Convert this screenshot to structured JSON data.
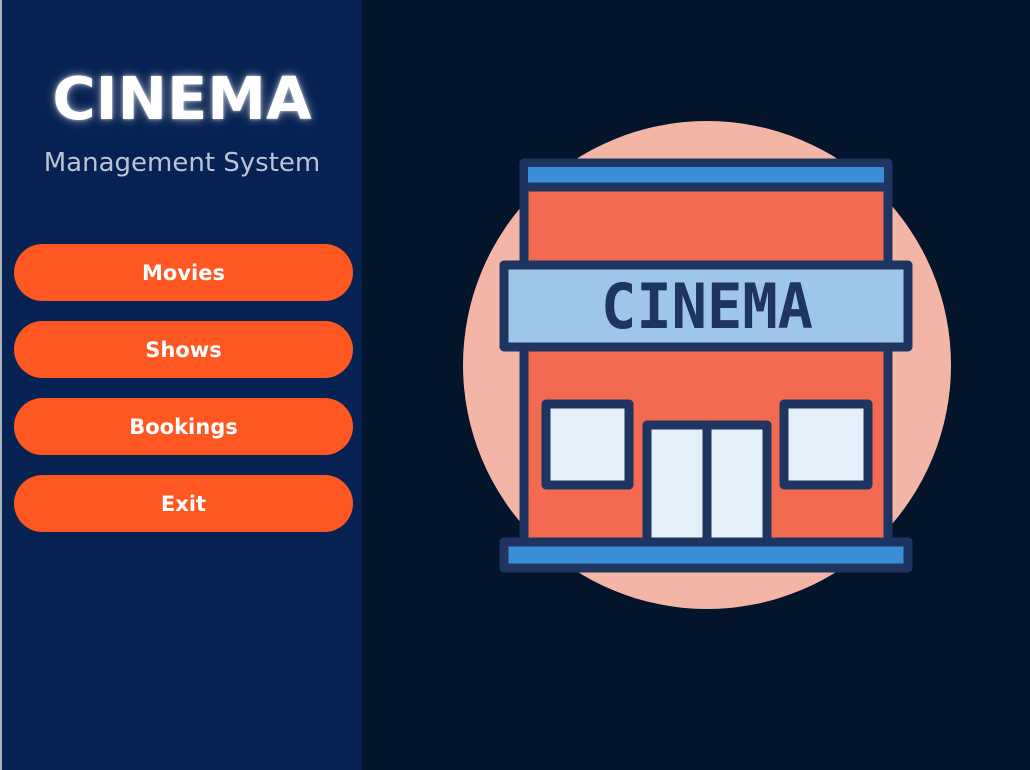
{
  "sidebar": {
    "title": "CINEMA",
    "subtitle": "Management System",
    "buttons": [
      {
        "label": "Movies"
      },
      {
        "label": "Shows"
      },
      {
        "label": "Bookings"
      },
      {
        "label": "Exit"
      }
    ]
  },
  "illustration": {
    "sign_text": "CINEMA",
    "icon": "cinema-building-icon"
  },
  "colors": {
    "sidebar_bg": "#062252",
    "content_bg": "#03142b",
    "button_bg": "#ff5722",
    "button_text": "#ffffff",
    "circle": "#f2b5a6",
    "building": "#f26b50",
    "outline": "#1f3561",
    "sign": "#9dc6e8",
    "window": "#e4f0f9"
  }
}
